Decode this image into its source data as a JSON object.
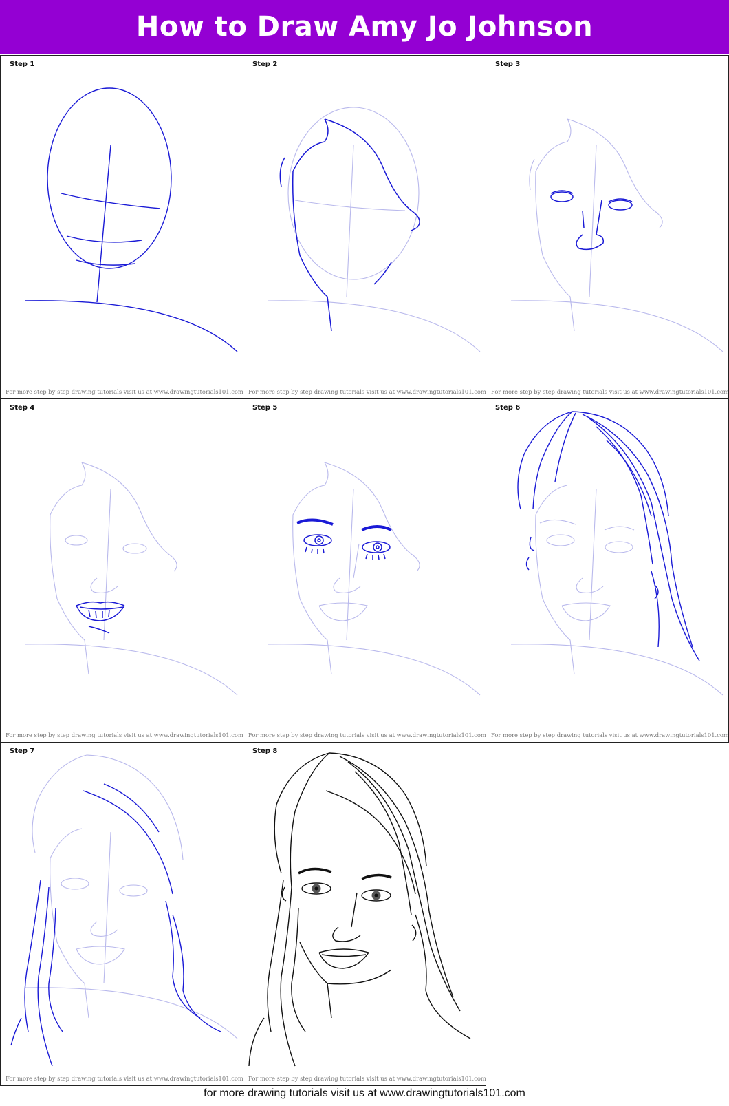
{
  "header": {
    "title": "How to Draw Amy Jo Johnson",
    "background": "#9400d3",
    "text_color": "#ffffff"
  },
  "steps": [
    {
      "label": "Step 1",
      "credit": "For more step by step drawing tutorials visit us at www.drawingtutorials101.com"
    },
    {
      "label": "Step 2",
      "credit": "For more step by step drawing tutorials visit us at www.drawingtutorials101.com"
    },
    {
      "label": "Step 3",
      "credit": "For more step by step drawing tutorials visit us at www.drawingtutorials101.com"
    },
    {
      "label": "Step 4",
      "credit": "For more step by step drawing tutorials visit us at www.drawingtutorials101.com"
    },
    {
      "label": "Step 5",
      "credit": "For more step by step drawing tutorials visit us at www.drawingtutorials101.com"
    },
    {
      "label": "Step 6",
      "credit": "For more step by step drawing tutorials visit us at www.drawingtutorials101.com"
    },
    {
      "label": "Step 7",
      "credit": "For more step by step drawing tutorials visit us at www.drawingtutorials101.com"
    },
    {
      "label": "Step 8",
      "credit": "For more step by step drawing tutorials visit us at www.drawingtutorials101.com"
    }
  ],
  "colors": {
    "new_stroke": "#1a1ad6",
    "guide_stroke": "#b9b9ec",
    "final_stroke": "#111111"
  },
  "footer": {
    "text": "for more drawing tutorials visit us at www.drawingtutorials101.com"
  }
}
